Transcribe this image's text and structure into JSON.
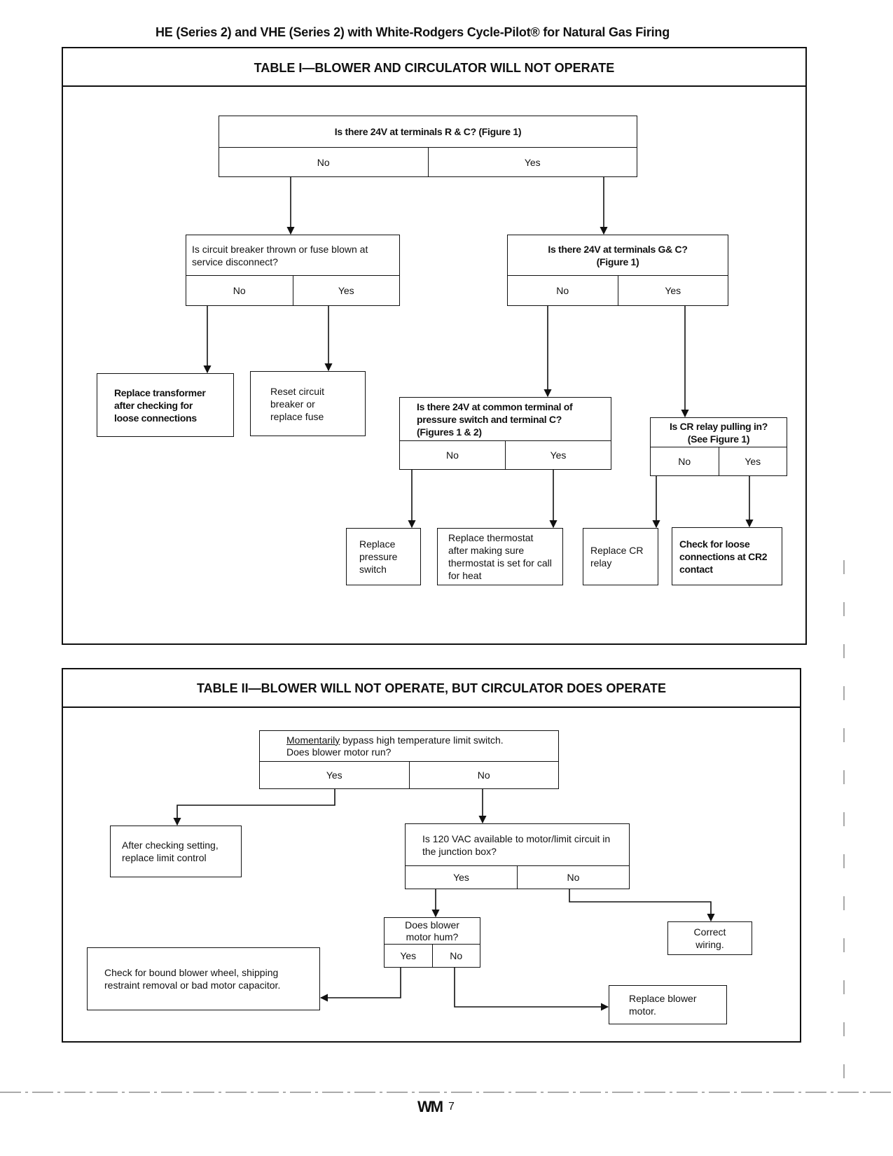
{
  "header": {
    "title": "HE (Series 2) and VHE (Series 2) with White-Rodgers Cycle-Pilot® for Natural Gas Firing"
  },
  "table1": {
    "title": "TABLE I—BLOWER AND CIRCULATOR WILL NOT OPERATE",
    "q_root": {
      "text": "Is there 24V at terminals R & C? (Figure 1)",
      "no": "No",
      "yes": "Yes"
    },
    "q_breaker": {
      "text": "Is circuit breaker thrown or fuse blown at service disconnect?",
      "no": "No",
      "yes": "Yes"
    },
    "q_gc": {
      "line1": "Is there 24V at terminals G& C?",
      "line2": "(Figure 1)",
      "no": "No",
      "yes": "Yes"
    },
    "a_transformer": "Replace transformer after checking for loose connections",
    "a_reset": "Reset circuit breaker or replace fuse",
    "q_pressure": {
      "text": "Is there 24V at common terminal of pressure switch and terminal C? (Figures 1 & 2)",
      "no": "No",
      "yes": "Yes"
    },
    "q_cr": {
      "line1": "Is CR relay pulling in?",
      "line2": "(See Figure 1)",
      "no": "No",
      "yes": "Yes"
    },
    "a_pressure": "Replace pressure switch",
    "a_thermostat": "Replace thermostat after making sure thermostat is set for call for heat",
    "a_cr": "Replace CR relay",
    "a_loose": "Check for loose connections at CR2 contact"
  },
  "table2": {
    "title": "TABLE II—BLOWER WILL NOT OPERATE, BUT CIRCULATOR DOES OPERATE",
    "q_bypass": {
      "line1_u": "Momentarily",
      "line1_rest": " bypass high temperature limit switch.",
      "line2": "Does blower motor run?",
      "yes": "Yes",
      "no": "No"
    },
    "a_limit": "After checking setting, replace limit control",
    "q_120": {
      "text": "Is 120 VAC available to motor/limit circuit in the junction box?",
      "yes": "Yes",
      "no": "No"
    },
    "q_hum": {
      "text": "Does blower motor hum?",
      "yes": "Yes",
      "no": "No"
    },
    "a_wiring": "Correct wiring.",
    "a_bound": "Check for bound blower wheel, shipping restraint removal or bad motor capacitor.",
    "a_replace_motor": "Replace blower motor."
  },
  "footer": {
    "logo": "WM",
    "page": "7"
  }
}
